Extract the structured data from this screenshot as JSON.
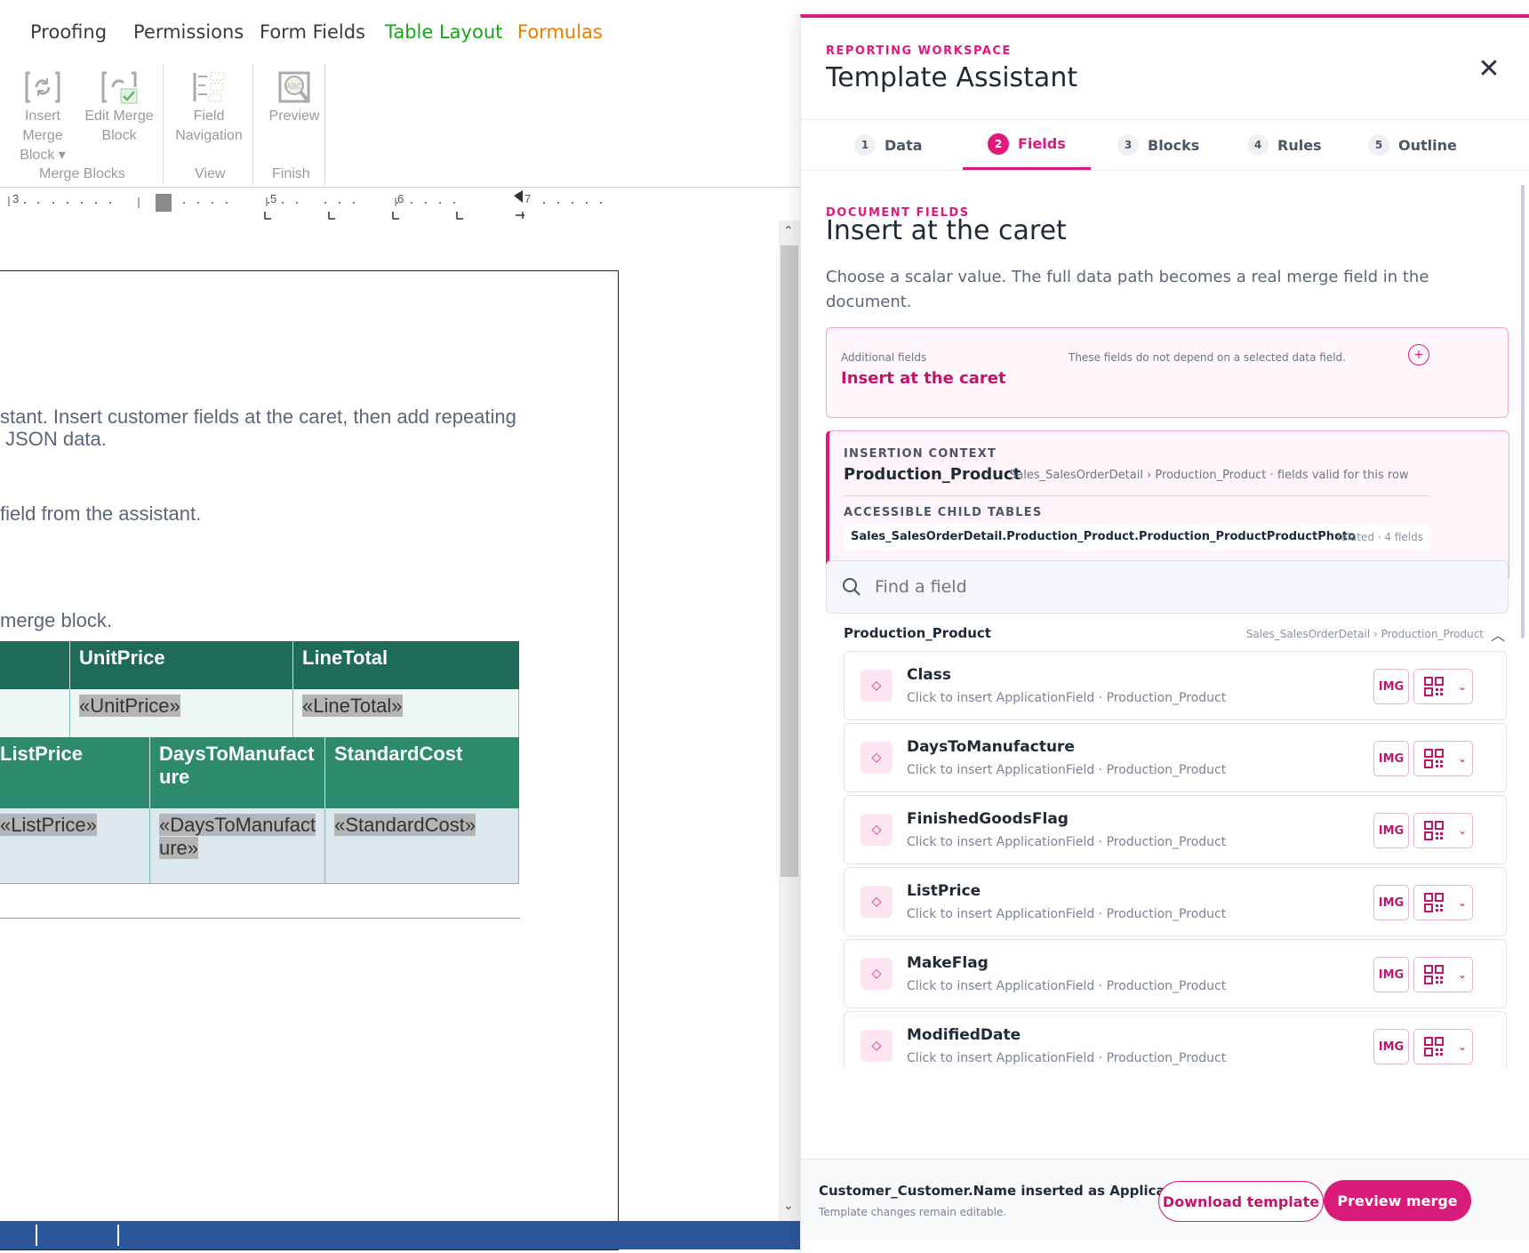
{
  "ribbon": {
    "tabs": [
      {
        "label": "Proofing",
        "color": "#3b3b3b"
      },
      {
        "label": "Permissions",
        "color": "#3b3b3b"
      },
      {
        "label": "Form Fields",
        "color": "#3b3b3b"
      },
      {
        "label": "Table Layout",
        "color": "#1aa31a"
      },
      {
        "label": "Formulas",
        "color": "#ea7a00"
      }
    ],
    "buttons": {
      "insert_merge_block": [
        "Insert Merge",
        "Block ▾"
      ],
      "edit_merge_block": [
        "Edit Merge",
        "Block"
      ],
      "field_navigation": [
        "Field",
        "Navigation"
      ],
      "preview": "Preview"
    },
    "groups": [
      "Merge Blocks",
      "View",
      "Finish"
    ]
  },
  "ruler": {
    "marks": [
      "3",
      "5",
      "6",
      "7"
    ]
  },
  "document": {
    "para1_line1": "stant. Insert customer fields at the caret, then add repeating",
    "para1_line2": " JSON data.",
    "para2": "field from the assistant.",
    "para3": "merge block.",
    "table1": {
      "headers": [
        "UnitPrice",
        "LineTotal"
      ],
      "cells": [
        "«UnitPrice»",
        "«LineTotal»"
      ]
    },
    "table2": {
      "headers": [
        "ListPrice",
        "DaysToManufact\nure",
        "StandardCost"
      ],
      "cells": [
        "«ListPrice»",
        "«DaysToManufact\nure»",
        "«StandardCost»"
      ]
    }
  },
  "panel": {
    "eyebrow": "REPORTING WORKSPACE",
    "title": "Template Assistant",
    "steps": [
      {
        "num": "1",
        "label": "Data"
      },
      {
        "num": "2",
        "label": "Fields"
      },
      {
        "num": "3",
        "label": "Blocks"
      },
      {
        "num": "4",
        "label": "Rules"
      },
      {
        "num": "5",
        "label": "Outline"
      }
    ],
    "active_step": "Fields",
    "section_eyebrow": "DOCUMENT FIELDS",
    "section_title": "Insert at the caret",
    "section_desc": "Choose a scalar value. The full data path becomes a real merge field in the document.",
    "additional": {
      "label": "Additional fields",
      "note": "These fields do not depend on a selected data field.",
      "action": "Insert at the caret"
    },
    "context": {
      "label": "INSERTION CONTEXT",
      "name": "Production_Product",
      "path": "Sales_SalesOrderDetail › Production_Product · fields valid for this row",
      "child_label": "ACCESSIBLE CHILD TABLES",
      "child_name": "Sales_SalesOrderDetail.Production_Product.Production_ProductProductPhoto",
      "child_meta": "related · 4 fields"
    },
    "search_placeholder": "Find a field",
    "group": {
      "name": "Production_Product",
      "path": "Sales_SalesOrderDetail › Production_Product"
    },
    "fields": [
      {
        "name": "Class",
        "sub": "Click to insert ApplicationField · Production_Product"
      },
      {
        "name": "DaysToManufacture",
        "sub": "Click to insert ApplicationField · Production_Product"
      },
      {
        "name": "FinishedGoodsFlag",
        "sub": "Click to insert ApplicationField · Production_Product"
      },
      {
        "name": "ListPrice",
        "sub": "Click to insert ApplicationField · Production_Product"
      },
      {
        "name": "MakeFlag",
        "sub": "Click to insert ApplicationField · Production_Product"
      },
      {
        "name": "ModifiedDate",
        "sub": "Click to insert ApplicationField · Production_Product"
      }
    ],
    "field_img_label": "IMG",
    "footer": {
      "status": "Customer_Customer.Name inserted as Applicatio...",
      "note": "Template changes remain editable.",
      "download": "Download template",
      "preview": "Preview merge"
    },
    "accent": "#e0197d"
  }
}
